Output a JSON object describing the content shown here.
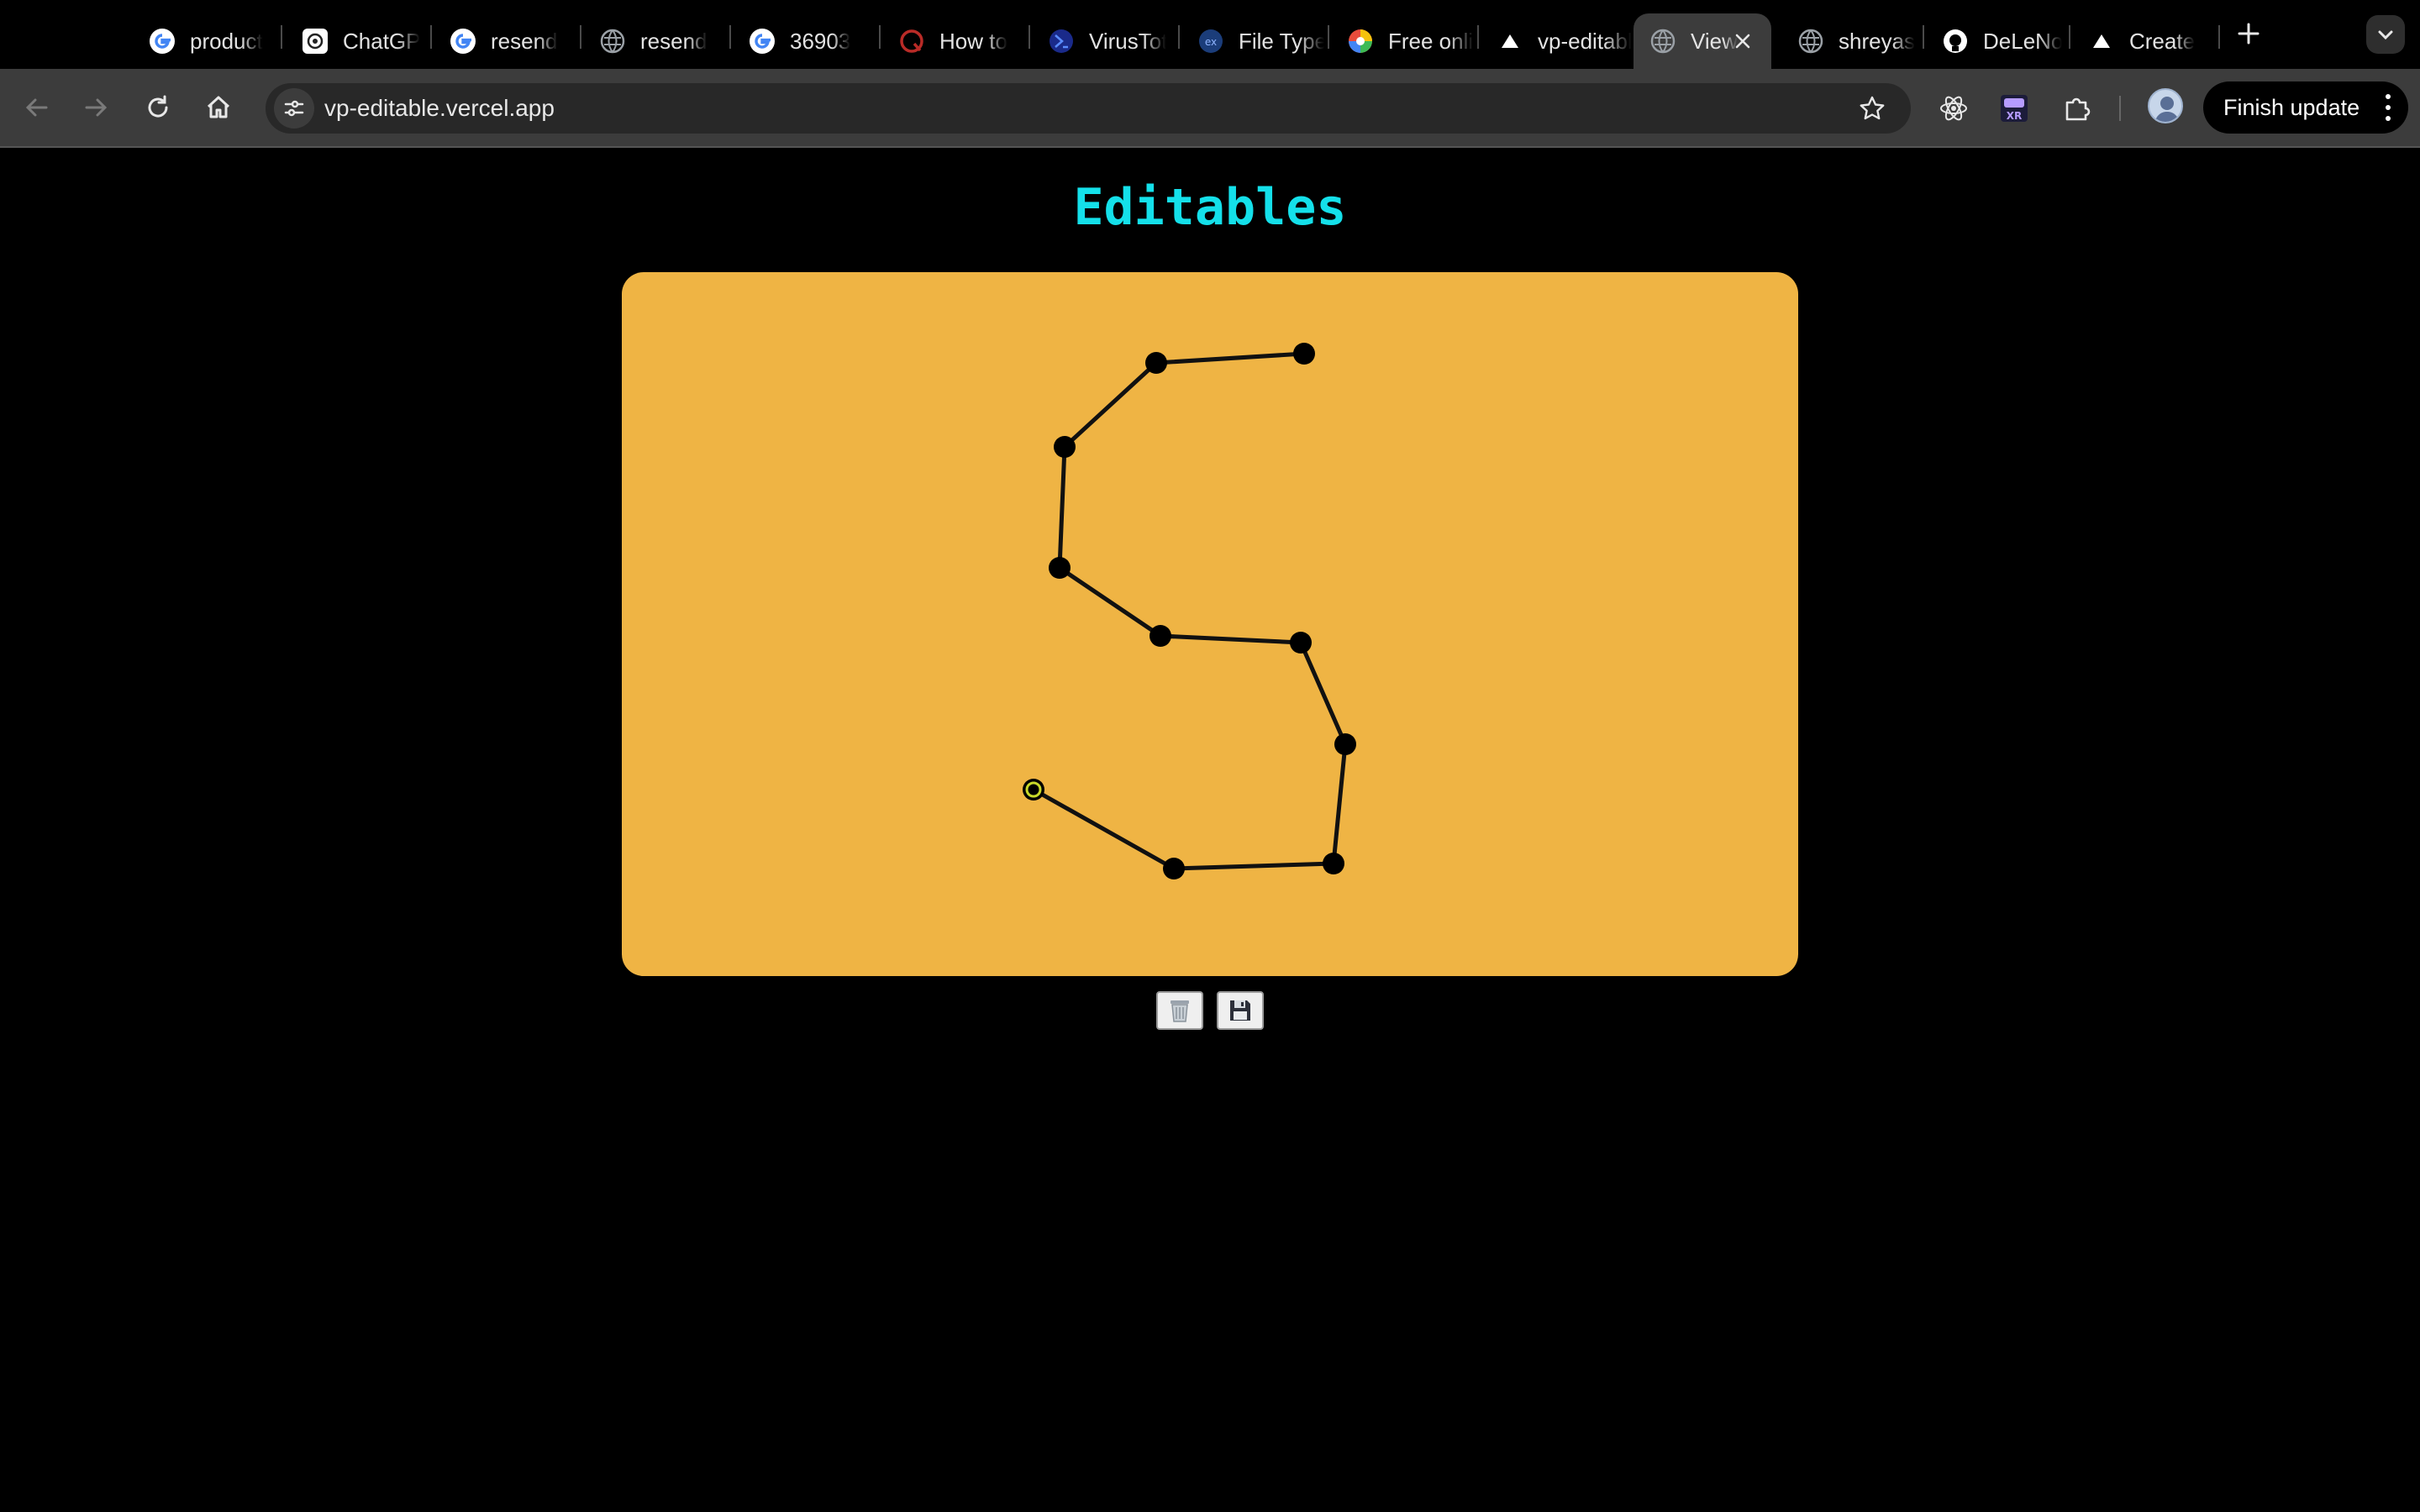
{
  "browser": {
    "tabs": [
      {
        "title": "product",
        "icon": "google-icon",
        "active": false
      },
      {
        "title": "ChatGPT",
        "icon": "chatgpt-icon",
        "active": false
      },
      {
        "title": "resend",
        "icon": "google-icon",
        "active": false
      },
      {
        "title": "resend",
        "icon": "globe-icon",
        "active": false
      },
      {
        "title": "36903",
        "icon": "google-icon",
        "active": false
      },
      {
        "title": "How to",
        "icon": "quora-icon",
        "active": false
      },
      {
        "title": "VirusTotal",
        "icon": "virustotal-icon",
        "active": false
      },
      {
        "title": "File Type",
        "icon": "filetype-icon",
        "active": false
      },
      {
        "title": "Free online",
        "icon": "color-wheel-icon",
        "active": false
      },
      {
        "title": "vp-editable",
        "icon": "vercel-icon",
        "active": false
      },
      {
        "title": "View",
        "icon": "globe-icon",
        "active": true
      },
      {
        "title": "shreyas",
        "icon": "globe-icon",
        "active": false
      },
      {
        "title": "DeLeNo",
        "icon": "github-icon",
        "active": false
      },
      {
        "title": "Create",
        "icon": "vercel-icon",
        "active": false
      }
    ],
    "address": {
      "url": "vp-editable.vercel.app"
    },
    "update_button": "Finish update"
  },
  "page": {
    "title": "Editables",
    "colors": {
      "title": "#14e0ea",
      "canvas": "#efb444",
      "point": "#000000",
      "selected_ring": "#c8d92a"
    },
    "buttons": [
      {
        "name": "clear",
        "icon": "trash-icon"
      },
      {
        "name": "save",
        "icon": "floppy-disk-icon"
      }
    ]
  }
}
